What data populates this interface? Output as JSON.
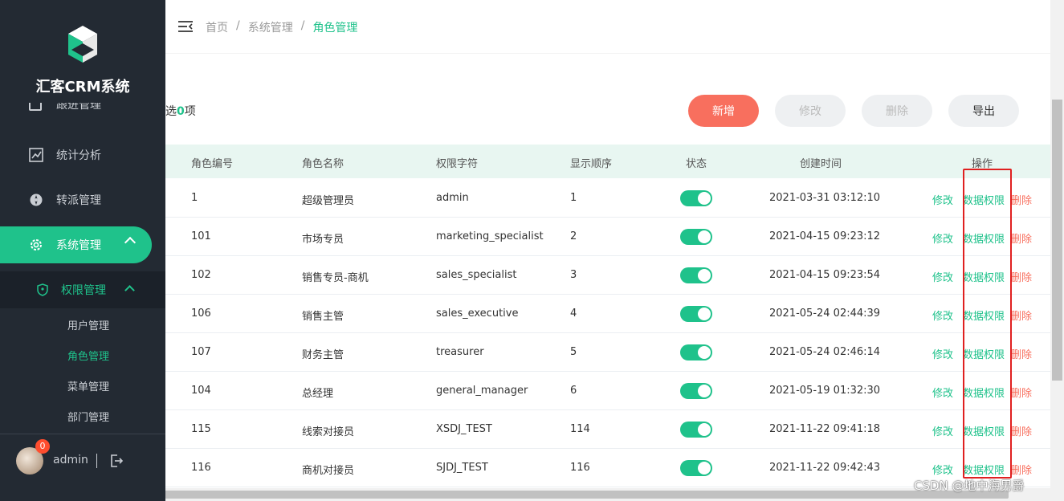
{
  "app": {
    "logo_text": "汇客CRM系统"
  },
  "sidebar": {
    "clipped_item": "跟进管理",
    "items": [
      {
        "label": "统计分析",
        "icon": "chart-icon"
      },
      {
        "label": "转派管理",
        "icon": "compass-icon"
      },
      {
        "label": "系统管理",
        "icon": "gear-icon"
      }
    ],
    "submenu": {
      "label": "权限管理",
      "icon": "shield-icon"
    },
    "sub_items": [
      "用户管理",
      "角色管理",
      "菜单管理",
      "部门管理"
    ]
  },
  "user": {
    "name": "admin",
    "badge": "0"
  },
  "header": {
    "breadcrumb": [
      "首页",
      "系统管理",
      "角色管理"
    ],
    "separator": "/"
  },
  "toolbar": {
    "selected_prefix": "选",
    "selected_count": "0",
    "selected_suffix": "项",
    "add_label": "新增",
    "edit_label": "修改",
    "delete_label": "删除",
    "export_label": "导出"
  },
  "table": {
    "headers": [
      "角色编号",
      "角色名称",
      "权限字符",
      "显示顺序",
      "状态",
      "创建时间",
      "操作"
    ],
    "actions": {
      "edit": "修改",
      "perm": "数据权限",
      "delete": "删除"
    },
    "rows": [
      {
        "id": "1",
        "name": "超级管理员",
        "key": "admin",
        "order": "1",
        "status": true,
        "created": "2021-03-31 03:12:10"
      },
      {
        "id": "101",
        "name": "市场专员",
        "key": "marketing_specialist",
        "order": "2",
        "status": true,
        "created": "2021-04-15 09:23:12"
      },
      {
        "id": "102",
        "name": "销售专员-商机",
        "key": "sales_specialist",
        "order": "3",
        "status": true,
        "created": "2021-04-15 09:23:54"
      },
      {
        "id": "106",
        "name": "销售主管",
        "key": "sales_executive",
        "order": "4",
        "status": true,
        "created": "2021-05-24 02:44:39"
      },
      {
        "id": "107",
        "name": "财务主管",
        "key": "treasurer",
        "order": "5",
        "status": true,
        "created": "2021-05-24 02:46:14"
      },
      {
        "id": "104",
        "name": "总经理",
        "key": "general_manager",
        "order": "6",
        "status": true,
        "created": "2021-05-19 01:32:30"
      },
      {
        "id": "115",
        "name": "线索对接员",
        "key": "XSDJ_TEST",
        "order": "114",
        "status": true,
        "created": "2021-11-22 09:41:18"
      },
      {
        "id": "116",
        "name": "商机对接员",
        "key": "SJDJ_TEST",
        "order": "116",
        "status": true,
        "created": "2021-11-22 09:42:43"
      }
    ]
  },
  "watermark": "CSDN @地中海男爵",
  "colors": {
    "accent": "#1fc28b",
    "danger": "#f86f5e",
    "sidebar": "#232a33"
  }
}
